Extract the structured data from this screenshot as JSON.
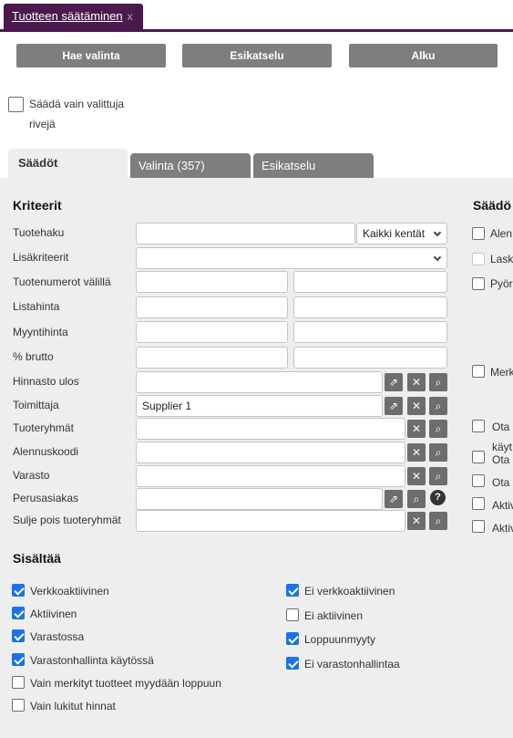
{
  "window": {
    "tab_title": "Tuotteen säätäminen",
    "close_glyph": "x"
  },
  "toolbar": {
    "fetch": "Hae valinta",
    "preview": "Esikatselu",
    "start": "Alku"
  },
  "only_selected": {
    "line1": "Säädä vain valittuja",
    "line2": "rivejä",
    "checked": false
  },
  "tabs": [
    "Säädöt",
    "Valinta (357)",
    "Esikatselu"
  ],
  "criteria": {
    "title": "Kriteerit",
    "product_search": "Tuotehaku",
    "search_scope": "Kaikki kentät",
    "extra_criteria": "Lisäkriteerit",
    "product_numbers": "Tuotenumerot välillä",
    "list_price": "Listahinta",
    "sale_price": "Myyntihinta",
    "gross_pct": "% brutto",
    "pricelist_out": "Hinnasto ulos",
    "supplier": "Toimittaja",
    "supplier_value": "Supplier 1",
    "product_groups": "Tuoteryhmät",
    "discount_code": "Alennuskoodi",
    "warehouse": "Varasto",
    "base_customer": "Perusasiakas",
    "exclude_groups": "Sulje pois tuoteryhmät"
  },
  "adjustments": {
    "title": "Säädö",
    "items": [
      "Alen",
      "Lask",
      "Pyör",
      "Merk",
      "Ota",
      "käyt",
      "Ota",
      "Ota",
      "Aktiv",
      "Aktiv"
    ]
  },
  "contains": {
    "title": "Sisältää",
    "left": [
      {
        "label": "Verkkoaktiivinen",
        "checked": true
      },
      {
        "label": "Aktiivinen",
        "checked": true
      },
      {
        "label": "Varastossa",
        "checked": true
      },
      {
        "label": "Varastonhallinta käytössä",
        "checked": true
      },
      {
        "label": "Vain merkityt tuotteet myydään loppuun",
        "checked": false
      },
      {
        "label": "Vain lukitut hinnat",
        "checked": false
      }
    ],
    "right": [
      {
        "label": "Ei verkkoaktiivinen",
        "checked": true
      },
      {
        "label": "Ei aktiivinen",
        "checked": false
      },
      {
        "label": "Loppuunmyyty",
        "checked": true
      },
      {
        "label": "Ei varastonhallintaa",
        "checked": true
      }
    ]
  },
  "icons": {
    "open": "external-link-icon",
    "clear": "close-icon",
    "search": "search-icon",
    "help": "help-icon"
  },
  "colors": {
    "accent": "#4a1a4e",
    "button": "#7e7e7e",
    "checkbox": "#1a73e8"
  }
}
